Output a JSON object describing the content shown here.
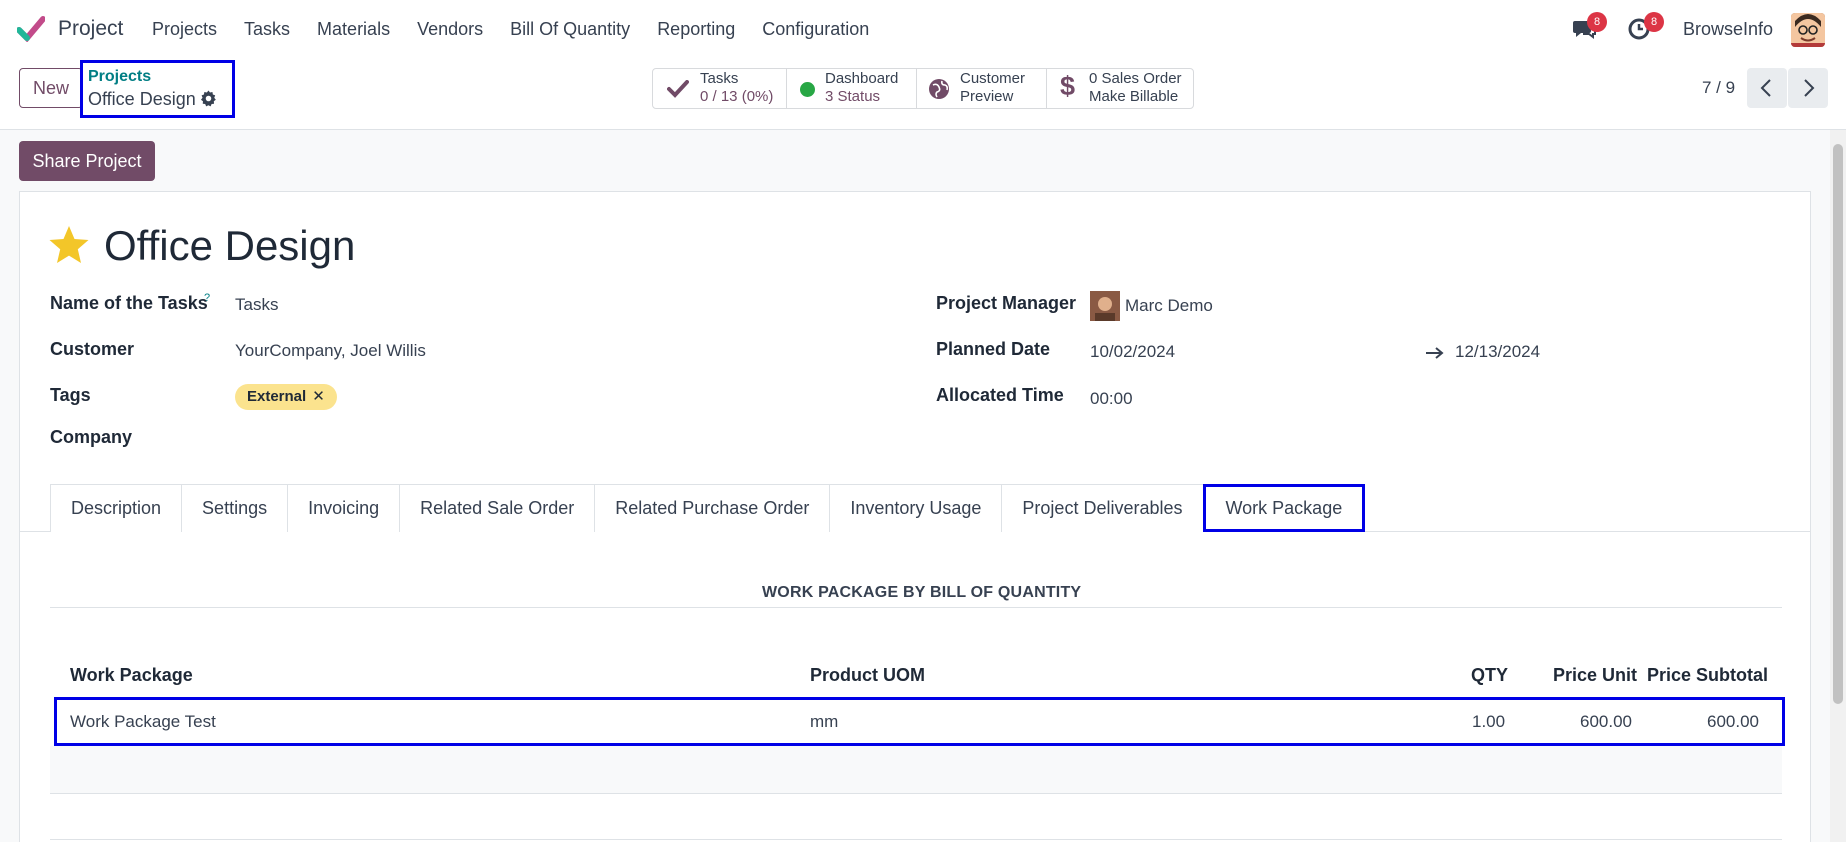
{
  "navbar": {
    "app_name": "Project",
    "menu": [
      "Projects",
      "Tasks",
      "Materials",
      "Vendors",
      "Bill Of Quantity",
      "Reporting",
      "Configuration"
    ],
    "chat_badge": "8",
    "activity_badge": "8",
    "company": "BrowseInfo"
  },
  "control": {
    "new_label": "New",
    "breadcrumb_parent": "Projects",
    "breadcrumb_current": "Office Design",
    "stats": [
      {
        "line1": "Tasks",
        "line2": "0 / 13 (0%)",
        "icon": "check-icon"
      },
      {
        "line1": "Dashboard",
        "line2": "3 Status",
        "icon": "status-dot-icon"
      },
      {
        "line1": "Customer",
        "line2": "Preview",
        "icon": "globe-icon"
      },
      {
        "line1": "0 Sales Order",
        "line2": "Make Billable",
        "icon": "dollar-icon"
      }
    ],
    "pager": "7 / 9"
  },
  "share_label": "Share Project",
  "record": {
    "title": "Office Design",
    "fields_left": {
      "name_of_tasks_label": "Name of the Tasks",
      "name_of_tasks_help": "?",
      "name_of_tasks_value": "Tasks",
      "customer_label": "Customer",
      "customer_value": "YourCompany, Joel Willis",
      "tags_label": "Tags",
      "tag_value": "External",
      "tag_remove": "✕",
      "company_label": "Company"
    },
    "fields_right": {
      "pm_label": "Project Manager",
      "pm_value": "Marc Demo",
      "planned_label": "Planned Date",
      "planned_start": "10/02/2024",
      "planned_end": "12/13/2024",
      "allocated_label": "Allocated Time",
      "allocated_value": "00:00"
    }
  },
  "tabs": [
    "Description",
    "Settings",
    "Invoicing",
    "Related Sale Order",
    "Related Purchase Order",
    "Inventory Usage",
    "Project Deliverables",
    "Work Package"
  ],
  "active_tab": "Work Package",
  "work_package": {
    "section_title": "WORK PACKAGE BY BILL OF QUANTITY",
    "columns": [
      "Work Package",
      "Product UOM",
      "QTY",
      "Price Unit",
      "Price Subtotal"
    ],
    "rows": [
      {
        "work_package": "Work Package Test",
        "uom": "mm",
        "qty": "1.00",
        "price_unit": "600.00",
        "subtotal": "600.00"
      }
    ]
  },
  "colors": {
    "brand": "#714b67",
    "link": "#017e84",
    "highlight": "#0000e6",
    "tag": "#fbe38e"
  }
}
